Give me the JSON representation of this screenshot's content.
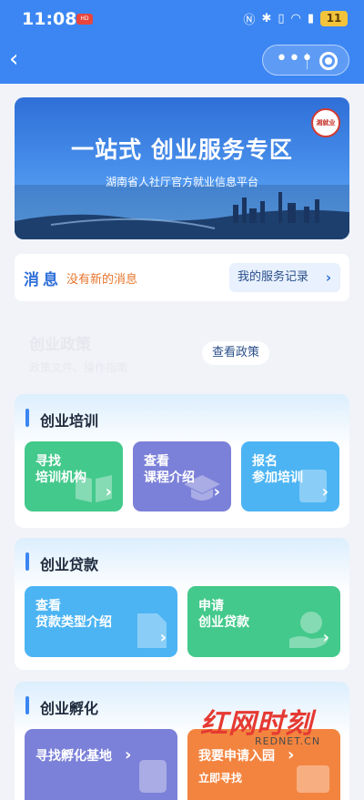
{
  "status_bar": {
    "time": "11:08",
    "badge": "HD",
    "battery": "11"
  },
  "nav": {
    "back_icon": "chevron-left-icon",
    "more_icon": "more-dots-icon",
    "close_icon": "target-ring-icon"
  },
  "banner": {
    "title": "一站式  创业服务专区",
    "subtitle": "湖南省人社厅官方就业信息平台",
    "seal_text": "湘就业"
  },
  "message": {
    "label": "消息",
    "text": "没有新的消息",
    "records_button": "我的服务记录"
  },
  "policy": {
    "title": "创业政策",
    "subtitle": "政策文件、操作指南",
    "button": "查看政策"
  },
  "training": {
    "title": "创业培训",
    "cards": [
      {
        "line1": "寻找",
        "line2": "培训机构",
        "icon": "book-icon",
        "color": "#43c98b"
      },
      {
        "line1": "查看",
        "line2": "课程介绍",
        "icon": "graduation-cap-icon",
        "color": "#7b80d8"
      },
      {
        "line1": "报名",
        "line2": "参加培训",
        "icon": "form-icon",
        "color": "#4cb4f3"
      }
    ]
  },
  "loan": {
    "title": "创业贷款",
    "cards": [
      {
        "line1": "查看",
        "line2": "贷款类型介绍",
        "icon": "document-icon",
        "color": "#4cb4f3"
      },
      {
        "line1": "申请",
        "line2": "创业贷款",
        "icon": "yuan-hand-icon",
        "color": "#43c98b"
      }
    ]
  },
  "incubation": {
    "title": "创业孵化",
    "cards": [
      {
        "line1": "寻找孵化基地",
        "line2": "",
        "icon": "page-icon",
        "color": "#7b80d8"
      },
      {
        "line1": "我要申请入园",
        "line2": "立即寻找",
        "icon": "building-icon",
        "color": "#f3843f"
      }
    ]
  },
  "watermark": {
    "main": "红网时刻",
    "sub": "REDNET.CN"
  }
}
